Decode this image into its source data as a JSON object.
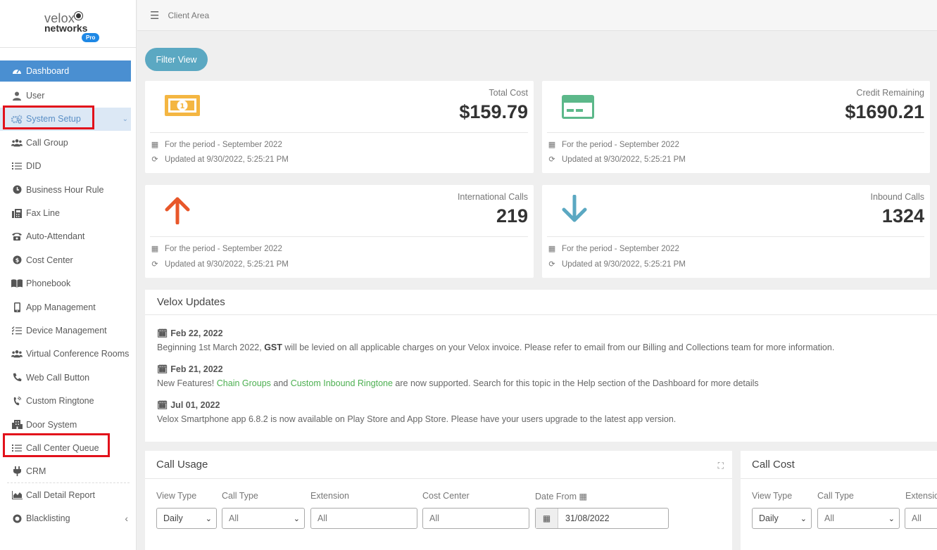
{
  "logo": {
    "line1": "velox",
    "line2": "networks",
    "badge": "Pro"
  },
  "sidebar": {
    "items": [
      {
        "label": "Dashboard",
        "icon": "dashboard-gauge-icon"
      },
      {
        "label": "User",
        "icon": "user-icon"
      },
      {
        "label": "System Setup",
        "icon": "cogs-icon"
      },
      {
        "label": "Call Group",
        "icon": "users-icon"
      },
      {
        "label": "DID",
        "icon": "list-icon"
      },
      {
        "label": "Business Hour Rule",
        "icon": "clock-icon"
      },
      {
        "label": "Fax Line",
        "icon": "fax-icon"
      },
      {
        "label": "Auto-Attendant",
        "icon": "phone-icon"
      },
      {
        "label": "Cost Center",
        "icon": "coin-icon"
      },
      {
        "label": "Phonebook",
        "icon": "book-icon"
      },
      {
        "label": "App Management",
        "icon": "mobile-icon"
      },
      {
        "label": "Device Management",
        "icon": "tasks-icon"
      },
      {
        "label": "Virtual Conference Rooms",
        "icon": "users-icon"
      },
      {
        "label": "Web Call Button",
        "icon": "phone-handset-icon"
      },
      {
        "label": "Custom Ringtone",
        "icon": "ringtone-icon"
      },
      {
        "label": "Door System",
        "icon": "building-icon"
      },
      {
        "label": "Call Center Queue",
        "icon": "list-icon"
      },
      {
        "label": "CRM",
        "icon": "plug-icon"
      },
      {
        "label": "Call Detail Report",
        "icon": "area-chart-icon"
      },
      {
        "label": "Blacklisting",
        "icon": "ban-icon"
      }
    ]
  },
  "topbar": {
    "title": "Client Area"
  },
  "filter_button": "Filter View",
  "cards": [
    {
      "label": "Total Cost",
      "value": "$159.79",
      "period": "For the period - September 2022",
      "updated": "Updated at 9/30/2022, 5:25:21 PM",
      "icon": "money-bill-icon",
      "color": "#f4b642"
    },
    {
      "label": "Credit Remaining",
      "value": "$1690.21",
      "period": "For the period - September 2022",
      "updated": "Updated at 9/30/2022, 5:25:21 PM",
      "icon": "credit-card-icon",
      "color": "#5cb88a"
    },
    {
      "label": "International Calls",
      "value": "219",
      "period": "For the period - September 2022",
      "updated": "Updated at 9/30/2022, 5:25:21 PM",
      "icon": "arrow-up-icon",
      "color": "#e8572a"
    },
    {
      "label": "Inbound Calls",
      "value": "1324",
      "period": "For the period - September 2022",
      "updated": "Updated at 9/30/2022, 5:25:21 PM",
      "icon": "arrow-down-icon",
      "color": "#5ba8c2"
    }
  ],
  "updates": {
    "title": "Velox Updates",
    "entries": [
      {
        "date": "Feb 22, 2022",
        "t1": "Beginning 1st March 2022, ",
        "b1": "GST",
        "t2": " will be levied on all applicable charges on your Velox invoice. Please refer to email from our Billing and Collections team for more information."
      },
      {
        "date": "Feb 21, 2022",
        "t1": "New Features! ",
        "g1": "Chain Groups",
        "t2": " and ",
        "g2": "Custom Inbound Ringtone",
        "t3": " are now supported. Search for this topic in the Help section of the Dashboard for more details"
      },
      {
        "date": "Jul 01, 2022",
        "t1": "Velox Smartphone app 6.8.2 is now available on Play Store and App Store. Please have your users upgrade to the latest app version."
      }
    ]
  },
  "call_usage": {
    "title": "Call Usage",
    "labels": {
      "view_type": "View Type",
      "call_type": "Call Type",
      "extension": "Extension",
      "cost_center": "Cost Center",
      "date_from": "Date From"
    },
    "view_type": "Daily",
    "call_type": "All",
    "extension_placeholder": "All",
    "cost_center_placeholder": "All",
    "date_from": "31/08/2022"
  },
  "call_cost": {
    "title": "Call Cost",
    "labels": {
      "view_type": "View Type",
      "call_type": "Call Type",
      "extension": "Extensio"
    },
    "view_type": "Daily",
    "call_type": "All",
    "extension_placeholder": "All"
  }
}
